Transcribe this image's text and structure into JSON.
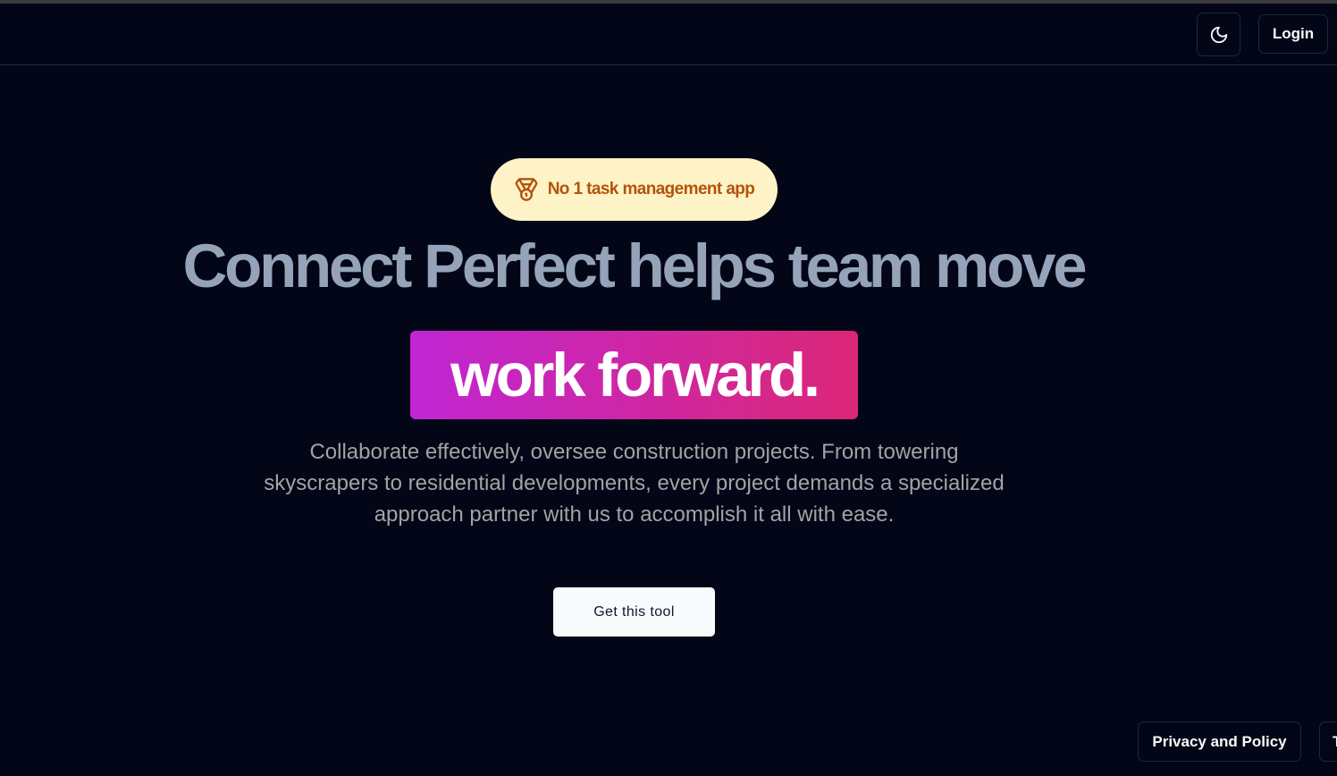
{
  "navbar": {
    "theme_toggle_icon": "moon-icon",
    "login_label": "Login"
  },
  "hero": {
    "badge_icon": "medal-icon",
    "badge_label": "No 1 task management app",
    "headline": "Connect Perfect helps team move",
    "highlight": "work forward.",
    "subtitle": "Collaborate effectively, oversee construction projects. From towering skyscrapers to residential developments, every project demands a specialized approach partner with us to accomplish it all with ease.",
    "cta_label": "Get this tool"
  },
  "footer": {
    "privacy_label": "Privacy and Policy",
    "terms_label": "T"
  },
  "colors": {
    "background": "#020617",
    "badge_bg": "#fef3c7",
    "badge_text": "#b45309",
    "headline": "#94a3b8",
    "gradient_start": "#c026d3",
    "gradient_end": "#db2777"
  }
}
